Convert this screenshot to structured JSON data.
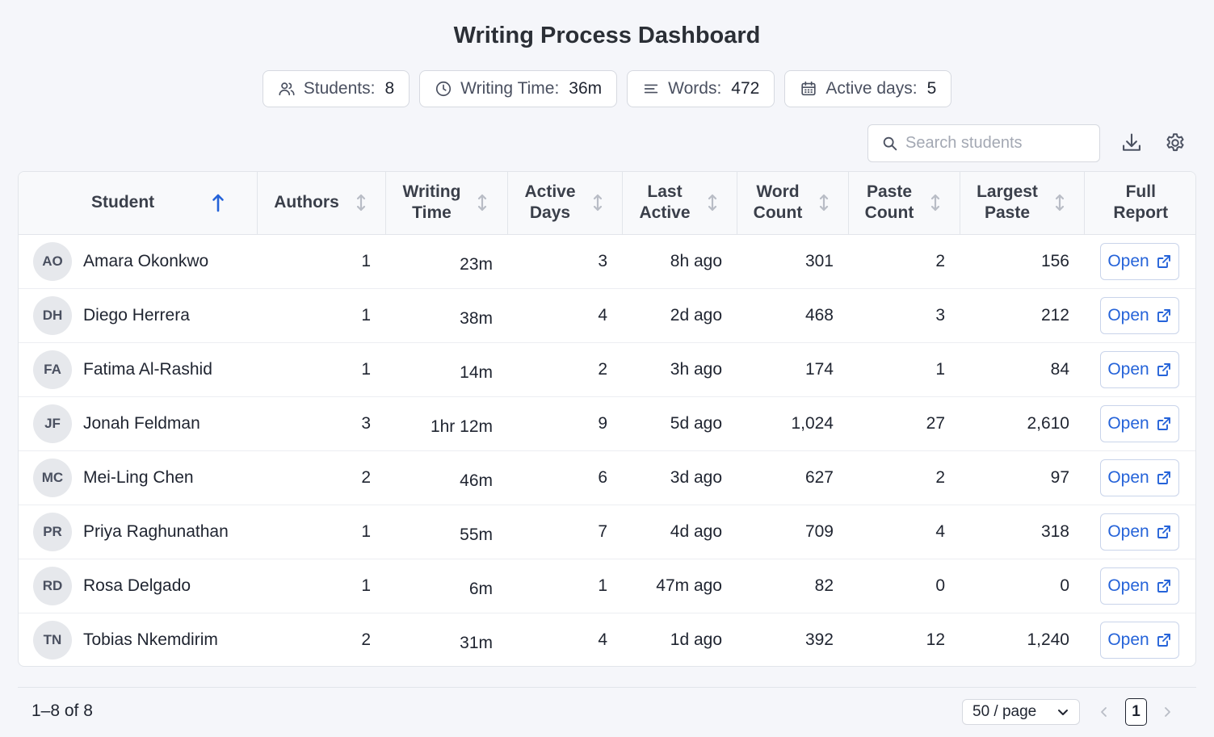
{
  "header": {
    "title": "Writing Process Dashboard"
  },
  "stats": [
    {
      "label": "Students:",
      "value": "8",
      "icon": "users-icon"
    },
    {
      "label": "Writing Time:",
      "value": "36m",
      "icon": "clock-icon"
    },
    {
      "label": "Words:",
      "value": "472",
      "icon": "lines-icon"
    },
    {
      "label": "Active days:",
      "value": "5",
      "icon": "calendar-icon"
    }
  ],
  "toolbar": {
    "search_placeholder": "Search students",
    "download_icon": "download-icon",
    "settings_icon": "gear-icon"
  },
  "table": {
    "columns": [
      {
        "line1": "Student",
        "line2": "",
        "sort": "asc"
      },
      {
        "line1": "Authors",
        "line2": "",
        "sort": "none"
      },
      {
        "line1": "Writing",
        "line2": "Time",
        "sort": "none"
      },
      {
        "line1": "Active",
        "line2": "Days",
        "sort": "none"
      },
      {
        "line1": "Last",
        "line2": "Active",
        "sort": "none"
      },
      {
        "line1": "Word",
        "line2": "Count",
        "sort": "none"
      },
      {
        "line1": "Paste",
        "line2": "Count",
        "sort": "none"
      },
      {
        "line1": "Largest",
        "line2": "Paste",
        "sort": "none"
      },
      {
        "line1": "Full",
        "line2": "Report",
        "sort": ""
      }
    ],
    "open_label": "Open",
    "rows": [
      {
        "initials": "AO",
        "name": "Amara Okonkwo",
        "authors": "1",
        "writing_time": "23m",
        "active_days": "3",
        "last_active": "8h ago",
        "word_count": "301",
        "paste_count": "2",
        "largest_paste": "156"
      },
      {
        "initials": "DH",
        "name": "Diego Herrera",
        "authors": "1",
        "writing_time": "38m",
        "active_days": "4",
        "last_active": "2d ago",
        "word_count": "468",
        "paste_count": "3",
        "largest_paste": "212"
      },
      {
        "initials": "FA",
        "name": "Fatima Al-Rashid",
        "authors": "1",
        "writing_time": "14m",
        "active_days": "2",
        "last_active": "3h ago",
        "word_count": "174",
        "paste_count": "1",
        "largest_paste": "84"
      },
      {
        "initials": "JF",
        "name": "Jonah Feldman",
        "authors": "3",
        "writing_time": "1hr 12m",
        "active_days": "9",
        "last_active": "5d ago",
        "word_count": "1,024",
        "paste_count": "27",
        "largest_paste": "2,610"
      },
      {
        "initials": "MC",
        "name": "Mei-Ling Chen",
        "authors": "2",
        "writing_time": "46m",
        "active_days": "6",
        "last_active": "3d ago",
        "word_count": "627",
        "paste_count": "2",
        "largest_paste": "97"
      },
      {
        "initials": "PR",
        "name": "Priya Raghunathan",
        "authors": "1",
        "writing_time": "55m",
        "active_days": "7",
        "last_active": "4d ago",
        "word_count": "709",
        "paste_count": "4",
        "largest_paste": "318"
      },
      {
        "initials": "RD",
        "name": "Rosa Delgado",
        "authors": "1",
        "writing_time": "6m",
        "active_days": "1",
        "last_active": "47m ago",
        "word_count": "82",
        "paste_count": "0",
        "largest_paste": "0"
      },
      {
        "initials": "TN",
        "name": "Tobias Nkemdirim",
        "authors": "2",
        "writing_time": "31m",
        "active_days": "4",
        "last_active": "1d ago",
        "word_count": "392",
        "paste_count": "12",
        "largest_paste": "1,240"
      }
    ]
  },
  "footer": {
    "range": "1–8 of 8",
    "page_size": "50 / page",
    "current_page": "1"
  },
  "colors": {
    "accent": "#2563d9",
    "sort_active": "#2563d9",
    "sort_inactive": "#b9bdc6"
  }
}
